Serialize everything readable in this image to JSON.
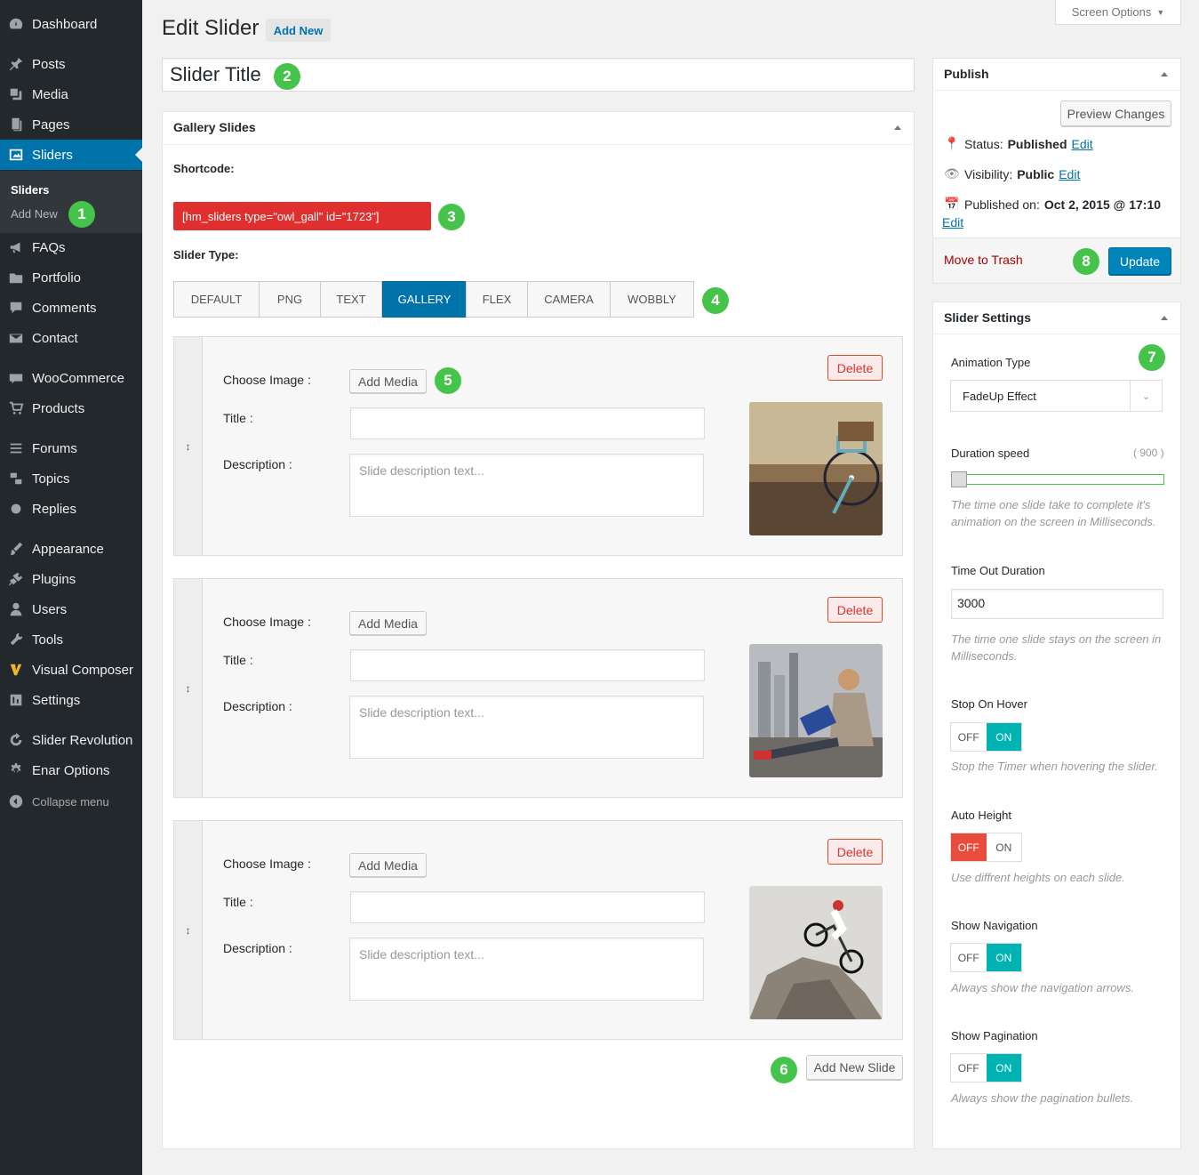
{
  "menu": [
    {
      "label": "Dashboard",
      "icon": "dashboard-icon"
    },
    {
      "label": "Posts",
      "icon": "pin-icon"
    },
    {
      "label": "Media",
      "icon": "media-icon"
    },
    {
      "label": "Pages",
      "icon": "pages-icon"
    },
    {
      "label": "Sliders",
      "icon": "slider-icon"
    },
    {
      "label": "FAQs",
      "icon": "megaphone-icon"
    },
    {
      "label": "Portfolio",
      "icon": "folder-icon"
    },
    {
      "label": "Comments",
      "icon": "comment-icon"
    },
    {
      "label": "Contact",
      "icon": "mail-icon"
    },
    {
      "label": "WooCommerce",
      "icon": "woo-icon"
    },
    {
      "label": "Products",
      "icon": "cart-icon"
    },
    {
      "label": "Forums",
      "icon": "forum-icon"
    },
    {
      "label": "Topics",
      "icon": "topics-icon"
    },
    {
      "label": "Replies",
      "icon": "replies-icon"
    },
    {
      "label": "Appearance",
      "icon": "brush-icon"
    },
    {
      "label": "Plugins",
      "icon": "plug-icon"
    },
    {
      "label": "Users",
      "icon": "user-icon"
    },
    {
      "label": "Tools",
      "icon": "wrench-icon"
    },
    {
      "label": "Visual Composer",
      "icon": "vc-icon"
    },
    {
      "label": "Settings",
      "icon": "settings-icon"
    },
    {
      "label": "Slider Revolution",
      "icon": "refresh-icon"
    },
    {
      "label": "Enar Options",
      "icon": "gear-icon"
    },
    {
      "label": "Collapse menu",
      "icon": "collapse-icon"
    }
  ],
  "submenu": {
    "current": "Sliders",
    "add_new": "Add New"
  },
  "header": {
    "title": "Edit Slider",
    "add_new": "Add New",
    "screen_options": "Screen Options"
  },
  "title_input": "Slider Title",
  "gallery": {
    "heading": "Gallery Slides",
    "shortcode_label": "Shortcode:",
    "shortcode": "[hm_sliders type=\"owl_gall\" id=\"1723\"]",
    "type_label": "Slider Type:",
    "tabs": [
      "DEFAULT",
      "PNG",
      "TEXT",
      "GALLERY",
      "FLEX",
      "CAMERA",
      "WOBBLY"
    ],
    "active_tab": "GALLERY",
    "slide_labels": {
      "choose": "Choose Image :",
      "add_media": "Add Media",
      "title": "Title :",
      "desc": "Description :",
      "placeholder": "Slide description text...",
      "delete": "Delete"
    },
    "add_slide": "Add New Slide"
  },
  "publish": {
    "heading": "Publish",
    "preview": "Preview Changes",
    "status_label": "Status:",
    "status": "Published",
    "visibility_label": "Visibility:",
    "visibility": "Public",
    "published_label": "Published on:",
    "published": "Oct 2, 2015 @ 17:10",
    "edit": "Edit",
    "trash": "Move to Trash",
    "update": "Update"
  },
  "settings": {
    "heading": "Slider Settings",
    "animation_label": "Animation Type",
    "animation": "FadeUp Effect",
    "duration_label": "Duration speed",
    "duration": "( 900 )",
    "duration_note": "The time one slide take to complete it's animation on the screen in Milliseconds.",
    "timeout_label": "Time Out Duration",
    "timeout": "3000",
    "timeout_note": "The time one slide stays on the screen in Milliseconds.",
    "hover_label": "Stop On Hover",
    "hover_note": "Stop the Timer when hovering the slider.",
    "height_label": "Auto Height",
    "height_note": "Use diffrent heights on each slide.",
    "nav_label": "Show Navigation",
    "nav_note": "Always show the navigation arrows.",
    "pag_label": "Show Pagination",
    "pag_note": "Always show the pagination bullets.",
    "off": "OFF",
    "on": "ON"
  },
  "badges": [
    "1",
    "2",
    "3",
    "4",
    "5",
    "6",
    "7",
    "8"
  ],
  "colors": {
    "accent": "#0073aa",
    "badge": "#46c34a",
    "shortcode": "#e02f2f",
    "toggle_on": "#00b3b3",
    "toggle_off": "#e74c3c"
  }
}
